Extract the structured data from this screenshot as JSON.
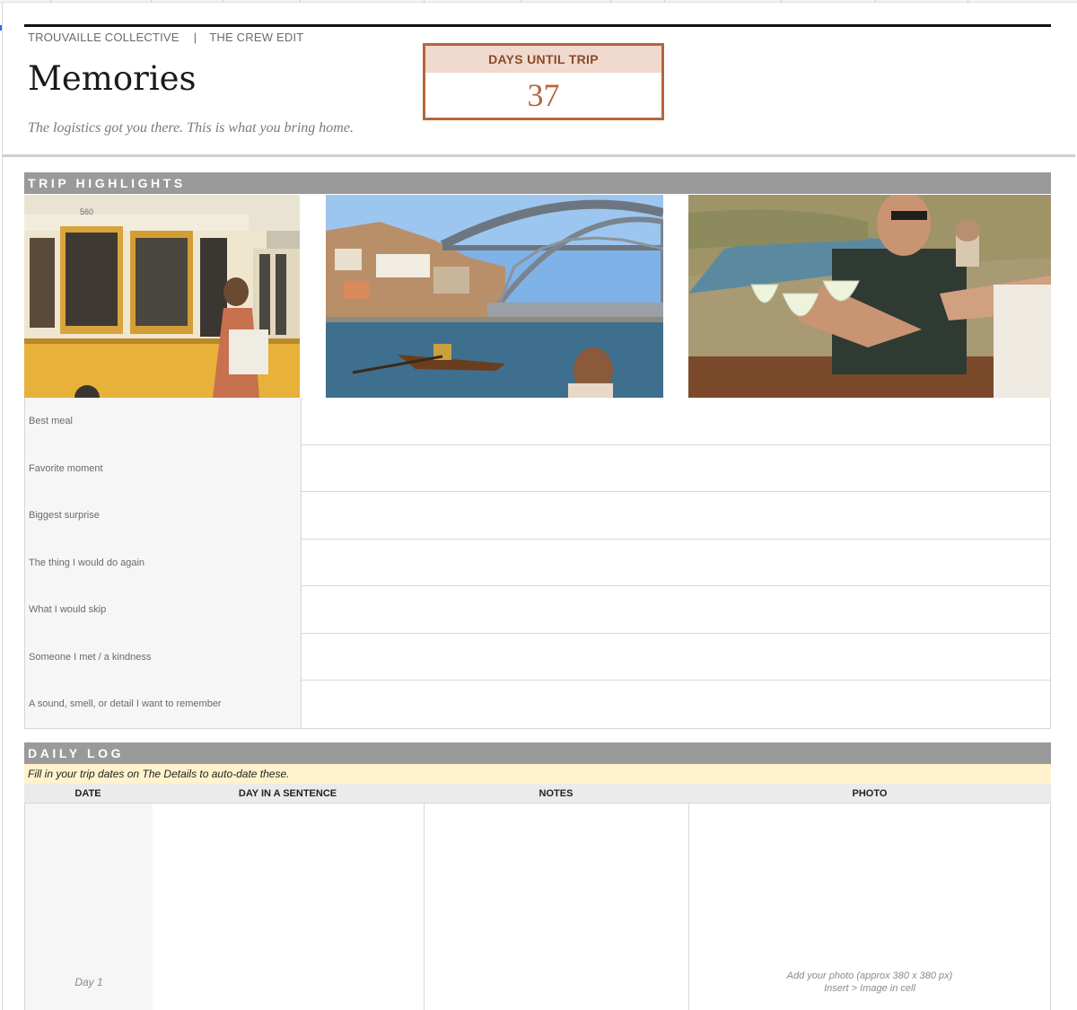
{
  "header": {
    "brand": "TROUVAILLE COLLECTIVE",
    "separator": "|",
    "edition": "THE CREW EDIT",
    "title": "Memories",
    "tagline": "The logistics got you there. This is what you bring home."
  },
  "countdown": {
    "label": "DAYS UNTIL TRIP",
    "value": "37"
  },
  "trip_highlights": {
    "section_title": "TRIP HIGHLIGHTS",
    "photos": [
      {
        "icon": "tram-photo",
        "tram_number": "560"
      },
      {
        "icon": "bridge-river-photo"
      },
      {
        "icon": "wine-toast-photo"
      }
    ],
    "rows": [
      {
        "label": "Best meal",
        "value": ""
      },
      {
        "label": "Favorite moment",
        "value": ""
      },
      {
        "label": "Biggest surprise",
        "value": ""
      },
      {
        "label": "The thing I would do again",
        "value": ""
      },
      {
        "label": "What I would skip",
        "value": ""
      },
      {
        "label": "Someone I met / a kindness",
        "value": ""
      },
      {
        "label": "A sound, smell, or detail I want to remember",
        "value": ""
      }
    ]
  },
  "daily_log": {
    "section_title": "DAILY LOG",
    "note": "Fill in your trip dates on The Details to auto-date these.",
    "columns": {
      "date": "DATE",
      "sentence": "DAY IN A SENTENCE",
      "notes": "NOTES",
      "photo": "PHOTO"
    },
    "entries": [
      {
        "date": "Day 1",
        "sentence": "",
        "notes": "",
        "photo_hint_line1": "Add your photo  (approx 380 x 380 px)",
        "photo_hint_line2": "Insert > Image in cell"
      }
    ]
  },
  "colors": {
    "accent": "#b4663c",
    "accent_light": "#f0d9cd",
    "section_bar": "#9a9a9a",
    "note_bg": "#fff2cc"
  }
}
